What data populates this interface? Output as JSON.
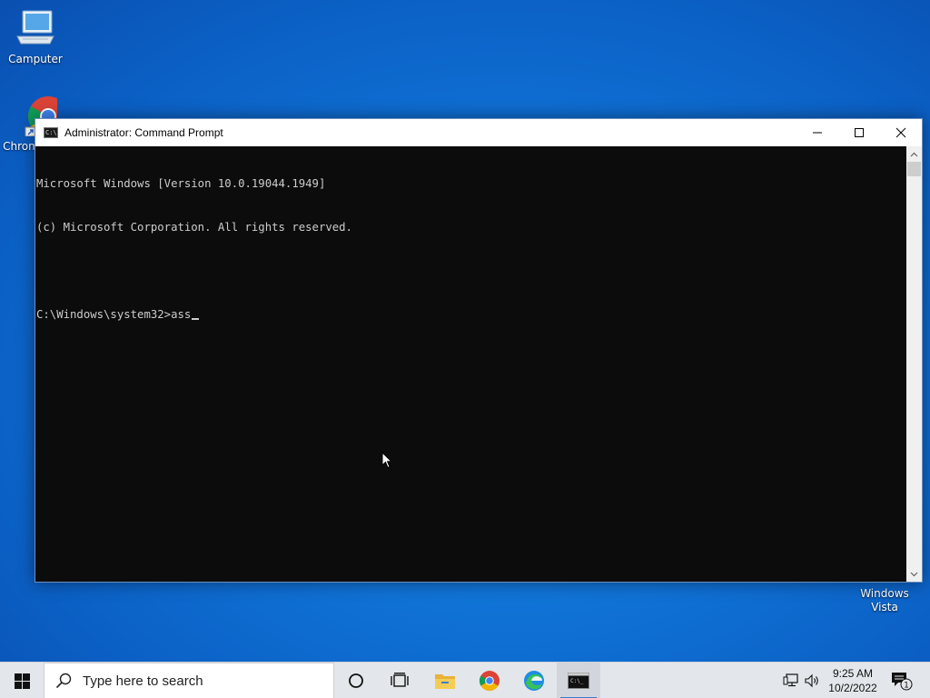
{
  "desktop": {
    "icons": [
      {
        "label": "Camputer",
        "icon": "computer-icon"
      },
      {
        "label": "Chrom",
        "icon": "chrome-icon"
      },
      {
        "label": "Windows\nVista",
        "icon": "shortcut-icon"
      }
    ]
  },
  "window": {
    "title": "Administrator: Command Prompt",
    "controls": [
      "minimize-icon",
      "maximize-icon",
      "close-icon"
    ],
    "console_lines": [
      "Microsoft Windows [Version 10.0.19044.1949]",
      "(c) Microsoft Corporation. All rights reserved.",
      "",
      "C:\\Windows\\system32>ass"
    ]
  },
  "taskbar": {
    "search_placeholder": "Type here to search",
    "apps": [
      "start-icon",
      "cortana-icon",
      "task-view-icon",
      "file-explorer-icon",
      "chrome-icon",
      "edge-icon",
      "command-prompt-icon"
    ],
    "clock_time": "9:25 AM",
    "clock_date": "10/2/2022",
    "notification_count": "1"
  },
  "colors": {
    "console_bg": "#0c0c0c",
    "console_text": "#cccccc",
    "taskbar_bg": "#e3e6ea",
    "accent": "#3b78c8"
  }
}
